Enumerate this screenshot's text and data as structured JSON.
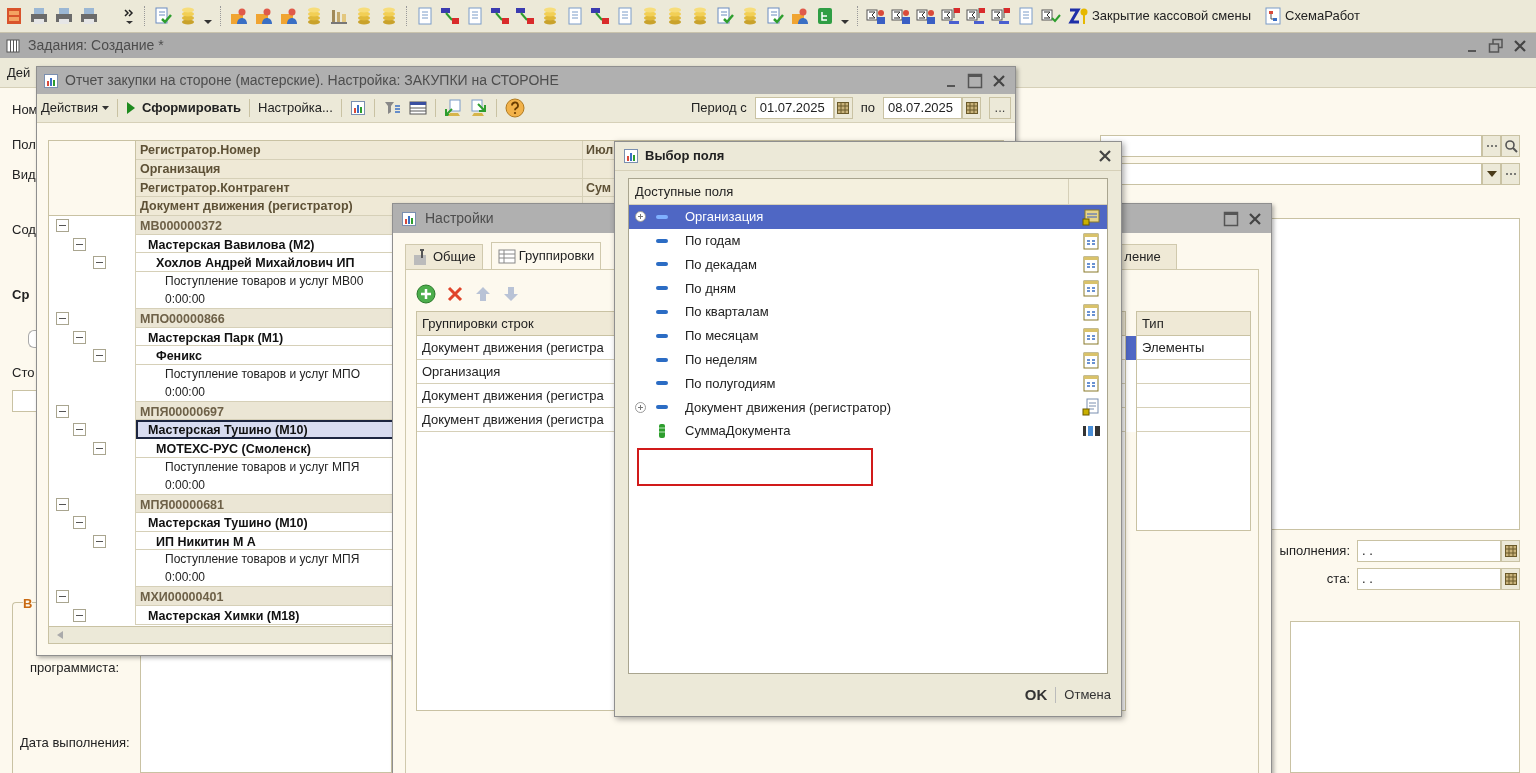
{
  "toolbar": {
    "buttons": [
      {
        "label": "Закрытие кассовой смены"
      },
      {
        "label": "СхемаРабот"
      }
    ]
  },
  "base_window": {
    "title": "Задания: Создание *",
    "menu": "Дей",
    "labels": [
      "Ном",
      "Пол",
      "Вид",
      "Сод",
      "Ср",
      "Сто"
    ],
    "group_title": "В",
    "bottom_labels": [
      "программиста:",
      "Дата выполнения:"
    ],
    "date_fields": [
      {
        "label": "ыполнения:",
        "value": ".  ."
      },
      {
        "label": "ста:",
        "value": ".  ."
      }
    ]
  },
  "report_window": {
    "title": "Отчет закупки на стороне (мастерские). Настройка: ЗАКУПКИ на СТОРОНЕ",
    "toolbar": {
      "actions": "Действия",
      "run": "Сформировать",
      "settings": "Настройка...",
      "period_from_label": "Период с",
      "period_from": "01.07.2025",
      "period_to_label": "по",
      "period_to": "08.07.2025",
      "more": "..."
    },
    "header_rows": [
      {
        "column_1": "Регистратор.Номер",
        "column_2": "Июл"
      },
      {
        "column_1": "Организация"
      },
      {
        "column_1": "Регистратор.Контрагент",
        "column_2": "Сум"
      },
      {
        "column_1": "Документ движения (регистратор)"
      }
    ],
    "tree": [
      {
        "text": "МВ000000372",
        "expanded": true,
        "selected": false,
        "children": [
          {
            "text": "Мастерская Вавилова (М2)",
            "expanded": true,
            "selected": false,
            "children": [
              {
                "text": "Хохлов Андрей Михайлович ИП",
                "expanded": true,
                "selected": false,
                "children": [
                  {
                    "lines": [
                      "Поступление товаров и услуг МВ00",
                      "0:00:00"
                    ],
                    "selected": false
                  }
                ]
              }
            ]
          }
        ]
      },
      {
        "text": "МПО00000866",
        "expanded": true,
        "selected": false,
        "children": [
          {
            "text": "Мастерская Парк (М1)",
            "expanded": true,
            "selected": false,
            "children": [
              {
                "text": "Феникс",
                "expanded": true,
                "selected": false,
                "children": [
                  {
                    "lines": [
                      "Поступление товаров и услуг МПО",
                      "0:00:00"
                    ],
                    "selected": false
                  }
                ]
              }
            ]
          }
        ]
      },
      {
        "text": "МПЯ00000697",
        "expanded": true,
        "selected": false,
        "children": [
          {
            "text": "Мастерская Тушино (М10)",
            "expanded": true,
            "selected": true,
            "children": [
              {
                "text": "МОТЕХС-РУС (Смоленск)",
                "expanded": true,
                "selected": false,
                "children": [
                  {
                    "lines": [
                      "Поступление товаров и услуг МПЯ",
                      "0:00:00"
                    ],
                    "selected": false
                  }
                ]
              }
            ]
          }
        ]
      },
      {
        "text": "МПЯ00000681",
        "expanded": true,
        "selected": false,
        "children": [
          {
            "text": "Мастерская Тушино (М10)",
            "expanded": true,
            "selected": false,
            "children": [
              {
                "text": "ИП Никитин М А",
                "expanded": true,
                "selected": false,
                "children": [
                  {
                    "lines": [
                      "Поступление товаров и услуг МПЯ",
                      "0:00:00"
                    ],
                    "selected": false
                  }
                ]
              }
            ]
          }
        ]
      },
      {
        "text": "МХИ00000401",
        "expanded": true,
        "selected": false,
        "children": [
          {
            "text": "Мастерская Химки (М18)",
            "expanded": true,
            "selected": false
          }
        ]
      }
    ]
  },
  "settings_window": {
    "title": "Настройки",
    "tabs": [
      {
        "label": "Общие",
        "selected": false
      },
      {
        "label": "Группировки",
        "selected": true
      },
      {
        "label": "ление",
        "selected": false
      }
    ],
    "column": "Группировки строк",
    "type_column": "Тип",
    "rows": [
      {
        "field": "Документ движения (регистра",
        "type": "Элементы",
        "selected": true
      },
      {
        "field": "Организация",
        "selected": false
      },
      {
        "field": "Документ движения (регистра",
        "selected": false
      },
      {
        "field": "Документ движения (регистра",
        "selected": false
      }
    ]
  },
  "field_dialog": {
    "title": "Выбор поля",
    "column": "Доступные поля",
    "items": [
      {
        "label": "Организация",
        "kind": "reference",
        "expandable": true,
        "selected": true
      },
      {
        "label": "По годам",
        "kind": "date",
        "expandable": false,
        "selected": false
      },
      {
        "label": "По декадам",
        "kind": "date",
        "expandable": false,
        "selected": false
      },
      {
        "label": "По дням",
        "kind": "date",
        "expandable": false,
        "selected": false
      },
      {
        "label": "По кварталам",
        "kind": "date",
        "expandable": false,
        "selected": false
      },
      {
        "label": "По месяцам",
        "kind": "date",
        "expandable": false,
        "selected": false
      },
      {
        "label": "По неделям",
        "kind": "date",
        "expandable": false,
        "selected": false
      },
      {
        "label": "По полугодиям",
        "kind": "date",
        "expandable": false,
        "selected": false
      },
      {
        "label": "Документ движения (регистратор)",
        "kind": "document",
        "expandable": true,
        "selected": false
      },
      {
        "label": "СуммаДокумента",
        "kind": "number",
        "expandable": false,
        "selected": false
      }
    ],
    "buttons": [
      {
        "label": "OK",
        "default": true
      },
      {
        "label": "Отмена",
        "default": false
      }
    ]
  }
}
